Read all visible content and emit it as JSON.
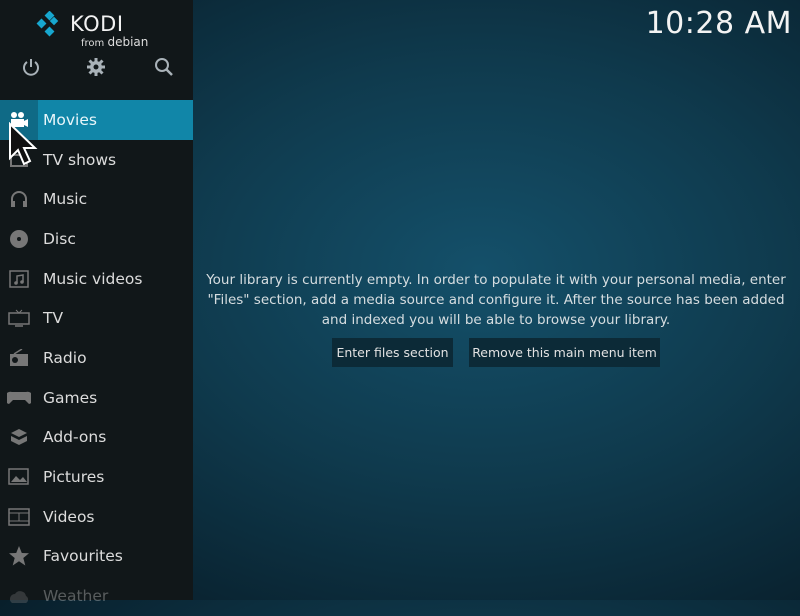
{
  "app": {
    "logo_text": "KODI",
    "logo_from": "from",
    "logo_distro": "debian"
  },
  "top_icons": [
    {
      "name": "power-icon"
    },
    {
      "name": "gear-icon"
    },
    {
      "name": "search-icon"
    }
  ],
  "clock": "10:28 AM",
  "menu": [
    {
      "label": "Movies",
      "icon": "movie-camera-icon",
      "active": true
    },
    {
      "label": "TV shows",
      "icon": "tv-shows-icon"
    },
    {
      "label": "Music",
      "icon": "headphones-icon"
    },
    {
      "label": "Disc",
      "icon": "disc-icon"
    },
    {
      "label": "Music videos",
      "icon": "music-video-icon"
    },
    {
      "label": "TV",
      "icon": "tv-icon"
    },
    {
      "label": "Radio",
      "icon": "radio-icon"
    },
    {
      "label": "Games",
      "icon": "gamepad-icon"
    },
    {
      "label": "Add-ons",
      "icon": "box-icon"
    },
    {
      "label": "Pictures",
      "icon": "picture-icon"
    },
    {
      "label": "Videos",
      "icon": "film-icon"
    },
    {
      "label": "Favourites",
      "icon": "star-icon"
    },
    {
      "label": "Weather",
      "icon": "weather-icon"
    }
  ],
  "main": {
    "message": "Your library is currently empty. In order to populate it with your personal media, enter \"Files\" section, add a media source and configure it. After the source has been added and indexed you will be able to browse your library.",
    "enter_files_label": "Enter files section",
    "remove_item_label": "Remove this main menu item"
  },
  "colors": {
    "accent": "#1186a8",
    "sidebar": "#111719",
    "background": "#0f3a4d"
  }
}
